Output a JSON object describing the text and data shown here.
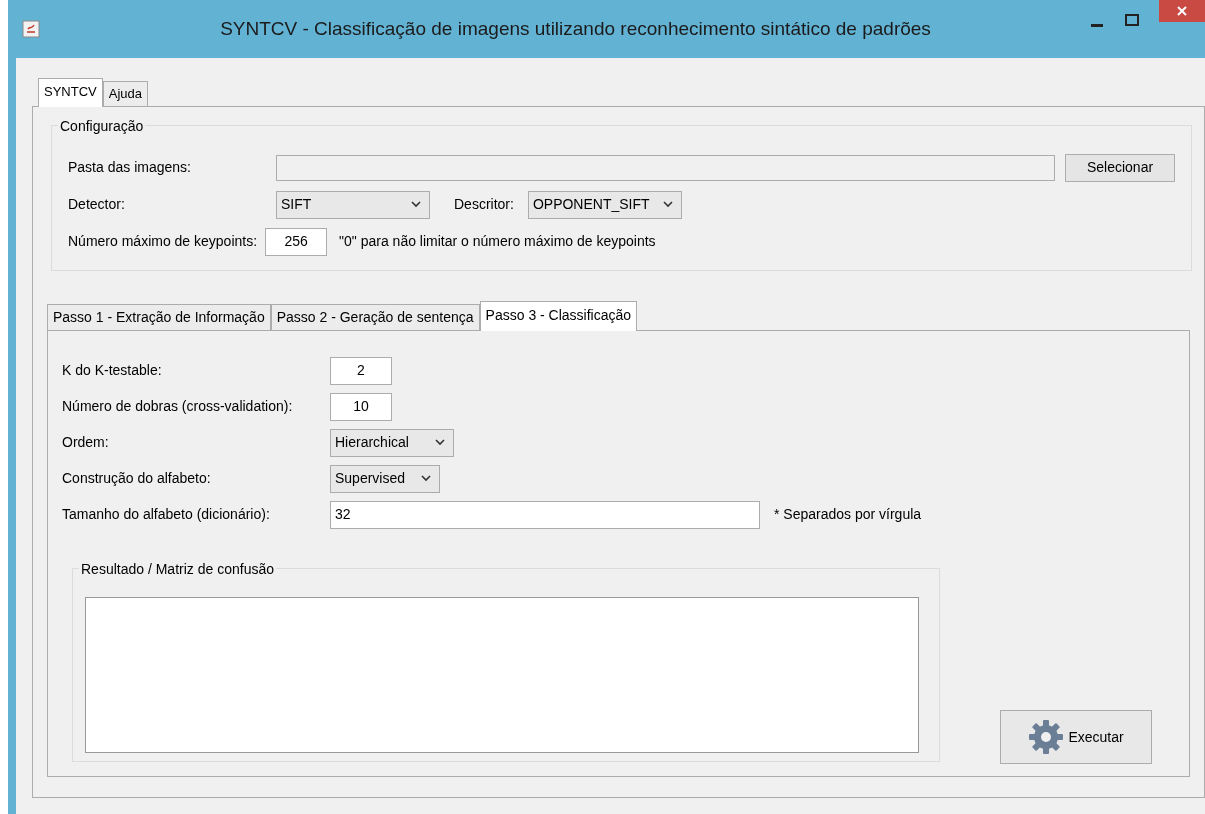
{
  "window": {
    "title": "SYNTCV  -  Classificação de imagens utilizando reconhecimento sintático de padrões"
  },
  "tabs": [
    {
      "label": "SYNTCV",
      "selected": true
    },
    {
      "label": "Ajuda",
      "selected": false
    }
  ],
  "configuracao": {
    "title": "Configuração",
    "folder": {
      "label": "Pasta das imagens:",
      "button": "Selecionar"
    },
    "detector": {
      "label": "Detector:",
      "value": "SIFT"
    },
    "descritor": {
      "label": "Descritor:",
      "value": "OPPONENT_SIFT"
    },
    "keypoints": {
      "label": "Número máximo de keypoints:",
      "value": "256",
      "hint": "\"0\" para não limitar o número máximo de keypoints"
    }
  },
  "steps": [
    {
      "label": "Passo 1 - Extração de Informação",
      "selected": false
    },
    {
      "label": "Passo 2 - Geração de sentença",
      "selected": false
    },
    {
      "label": "Passo 3 - Classificação",
      "selected": true
    }
  ],
  "form": [
    {
      "kind": "field",
      "label": "K do K-testable:",
      "value": "2"
    },
    {
      "kind": "field",
      "label": "Número de dobras (cross-validation):",
      "value": "10"
    },
    {
      "kind": "combo",
      "label": "Ordem:",
      "value": "Hierarchical"
    },
    {
      "kind": "combo",
      "label": "Construção do alfabeto:",
      "value": "Supervised"
    },
    {
      "kind": "wide",
      "label": "Tamanho do alfabeto (dicionário):",
      "value": "32",
      "note": "* Separados por vírgula"
    }
  ],
  "result": {
    "title": "Resultado / Matriz de confusão"
  },
  "run_button": "Executar"
}
